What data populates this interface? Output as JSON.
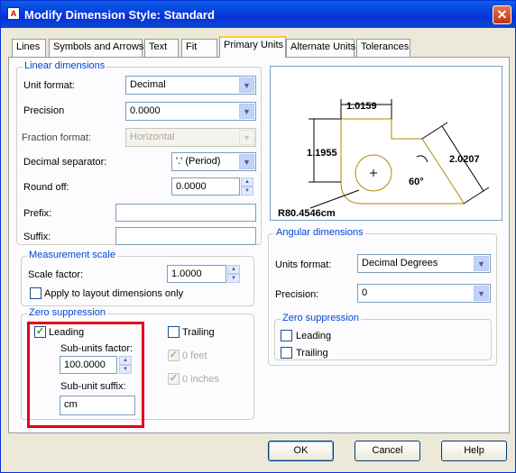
{
  "window": {
    "title": "Modify Dimension Style: Standard",
    "close_glyph": "✕"
  },
  "tabs": [
    {
      "label": "Lines"
    },
    {
      "label": "Symbols and Arrows"
    },
    {
      "label": "Text"
    },
    {
      "label": "Fit"
    },
    {
      "label": "Primary Units",
      "active": true
    },
    {
      "label": "Alternate Units"
    },
    {
      "label": "Tolerances"
    }
  ],
  "linear": {
    "legend": "Linear dimensions",
    "unit_format_label": "Unit format:",
    "unit_format_value": "Decimal",
    "precision_label": "Precision",
    "precision_value": "0.0000",
    "fraction_label": "Fraction format:",
    "fraction_value": "Horizontal",
    "decimal_sep_label": "Decimal separator:",
    "decimal_sep_value": "'.' (Period)",
    "round_off_label": "Round off:",
    "round_off_value": "0.0000",
    "prefix_label": "Prefix:",
    "prefix_value": "",
    "suffix_label": "Suffix:",
    "suffix_value": ""
  },
  "measurement": {
    "legend": "Measurement scale",
    "scale_label": "Scale factor:",
    "scale_value": "1.0000",
    "apply_layout_label": "Apply to layout dimensions only",
    "apply_layout_checked": false
  },
  "zero_linear": {
    "legend": "Zero suppression",
    "leading_label": "Leading",
    "leading_checked": true,
    "trailing_label": "Trailing",
    "trailing_checked": false,
    "subunits_factor_label": "Sub-units factor:",
    "subunits_factor_value": "100.0000",
    "subunit_suffix_label": "Sub-unit suffix:",
    "subunit_suffix_value": "cm",
    "feet_label": "0 feet",
    "feet_checked": true,
    "inches_label": "0 inches",
    "inches_checked": true
  },
  "preview": {
    "dim_top": "1.0159",
    "dim_left": "1.1955",
    "dim_right": "2.0207",
    "dim_angle": "60°",
    "dim_radius": "R80.4546cm"
  },
  "angular": {
    "legend": "Angular dimensions",
    "units_label": "Units format:",
    "units_value": "Decimal Degrees",
    "precision_label": "Precision:",
    "precision_value": "0",
    "zero_legend": "Zero suppression",
    "leading_label": "Leading",
    "leading_checked": false,
    "trailing_label": "Trailing",
    "trailing_checked": false
  },
  "buttons": {
    "ok": "OK",
    "cancel": "Cancel",
    "help": "Help"
  },
  "colors": {
    "highlight": "#e3001b",
    "legend": "#0046d5",
    "preview_lines": "#b08a00"
  }
}
